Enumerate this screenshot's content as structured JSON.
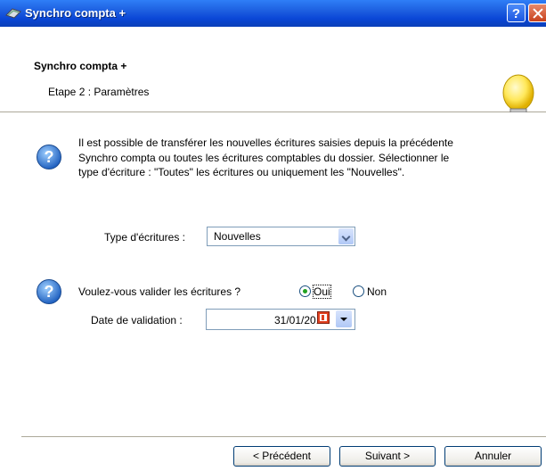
{
  "window": {
    "title": "Synchro compta +"
  },
  "header": {
    "title": "Synchro compta +",
    "subtitle": "Etape 2 : Paramètres"
  },
  "body": {
    "intro_lines": [
      "Il est possible de transférer les nouvelles écritures saisies depuis la précédente",
      "Synchro compta ou toutes les écritures comptables du dossier. Sélectionner le",
      "type d'écriture : \"Toutes\" les écritures ou uniquement les \"Nouvelles\"."
    ],
    "type_label": "Type d'écritures :",
    "type_value": "Nouvelles",
    "validate_question": "Voulez-vous valider les écritures ?",
    "radio_yes": "Oui",
    "radio_no": "Non",
    "radio_selected": "Oui",
    "date_label": "Date de validation :",
    "date_value": "31/01/2010"
  },
  "footer": {
    "prev_label": "< Précédent",
    "next_label": "Suivant >",
    "cancel_label": "Annuler"
  },
  "icons": {
    "help": "help-icon",
    "question": "question-icon",
    "bulb": "lightbulb-icon",
    "calendar": "calendar-icon"
  }
}
